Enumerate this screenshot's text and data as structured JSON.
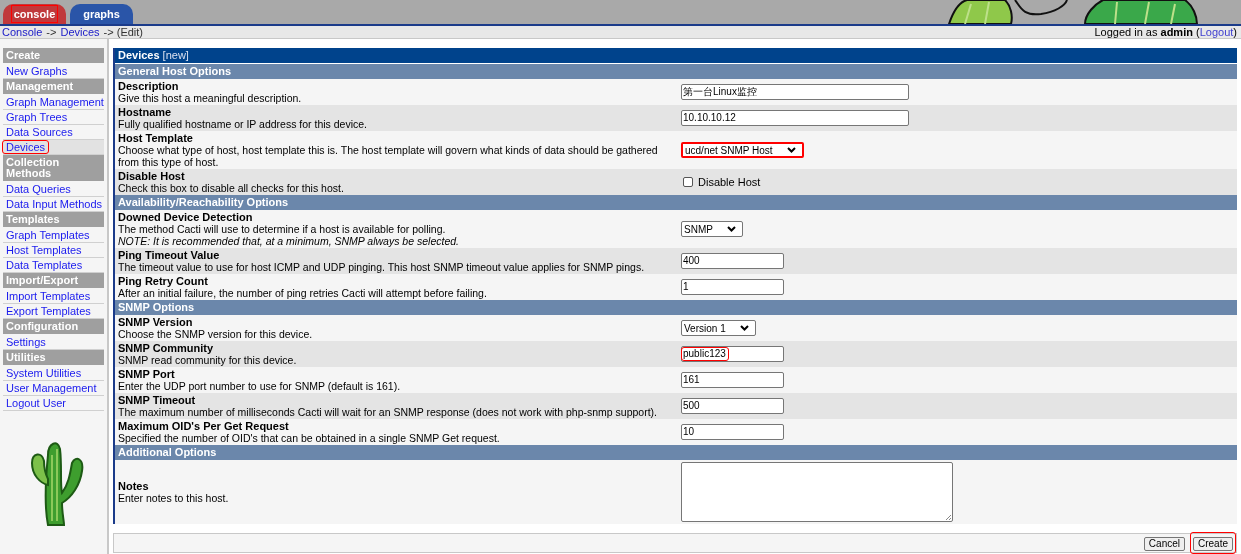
{
  "tabs": [
    {
      "label": "console",
      "selected": true,
      "highlighted": true
    },
    {
      "label": "graphs",
      "selected": false,
      "highlighted": false
    }
  ],
  "breadcrumb": [
    {
      "text": "Console",
      "kind": "link"
    },
    {
      "text": "->",
      "kind": "text"
    },
    {
      "text": "Devices",
      "kind": "link"
    },
    {
      "text": "-> (Edit)",
      "kind": "text"
    }
  ],
  "login": {
    "before": "Logged in as **admin** (",
    "link": "Logout",
    "after": ")"
  },
  "sidebar": {
    "items": [
      {
        "kind": "header",
        "label": "Create"
      },
      {
        "kind": "link",
        "label": "New Graphs",
        "selected": false,
        "highlighted": false
      },
      {
        "kind": "header",
        "label": "Management"
      },
      {
        "kind": "link",
        "label": "Graph Management",
        "selected": false,
        "highlighted": false
      },
      {
        "kind": "link",
        "label": "Graph Trees",
        "selected": false,
        "highlighted": false
      },
      {
        "kind": "link",
        "label": "Data Sources",
        "selected": false,
        "highlighted": false
      },
      {
        "kind": "link",
        "label": "Devices",
        "selected": true,
        "highlighted": true
      },
      {
        "kind": "header",
        "label": "Collection Methods"
      },
      {
        "kind": "link",
        "label": "Data Queries",
        "selected": false,
        "highlighted": false
      },
      {
        "kind": "link",
        "label": "Data Input Methods",
        "selected": false,
        "highlighted": false
      },
      {
        "kind": "header",
        "label": "Templates"
      },
      {
        "kind": "link",
        "label": "Graph Templates",
        "selected": false,
        "highlighted": false
      },
      {
        "kind": "link",
        "label": "Host Templates",
        "selected": false,
        "highlighted": false
      },
      {
        "kind": "link",
        "label": "Data Templates",
        "selected": false,
        "highlighted": false
      },
      {
        "kind": "header",
        "label": "Import/Export"
      },
      {
        "kind": "link",
        "label": "Import Templates",
        "selected": false,
        "highlighted": false
      },
      {
        "kind": "link",
        "label": "Export Templates",
        "selected": false,
        "highlighted": false
      },
      {
        "kind": "header",
        "label": "Configuration"
      },
      {
        "kind": "link",
        "label": "Settings",
        "selected": false,
        "highlighted": false
      },
      {
        "kind": "header",
        "label": "Utilities"
      },
      {
        "kind": "link",
        "label": "System Utilities",
        "selected": false,
        "highlighted": false
      },
      {
        "kind": "link",
        "label": "User Management",
        "selected": false,
        "highlighted": false
      },
      {
        "kind": "link",
        "label": "Logout User",
        "selected": false,
        "highlighted": false
      }
    ]
  },
  "form": {
    "title": "Devices",
    "tag": "[new]",
    "sections": [
      {
        "title": "General Host Options",
        "rows": [
          {
            "label": "Description",
            "description": "Give this host a meaningful description.",
            "field": {
              "kind": "text",
              "value": "第一台Linux监控",
              "highlighted": false
            }
          },
          {
            "label": "Hostname",
            "description": "Fully qualified hostname or IP address for this device.",
            "field": {
              "kind": "text",
              "value": "10.10.10.12",
              "highlighted": false
            }
          },
          {
            "label": "Host Template",
            "description": "Choose what type of host, host template this is. The host template will govern what kinds of data should be gathered from this type of host.",
            "field": {
              "kind": "select",
              "value": "ucd/net SNMP Host",
              "highlighted": true
            }
          },
          {
            "label": "Disable Host",
            "description": "Check this box to disable all checks for this host.",
            "field": {
              "kind": "checkbox",
              "value": "Disable Host",
              "checked": false
            }
          }
        ]
      },
      {
        "title": "Availability/Reachability Options",
        "rows": [
          {
            "label": "Downed Device Detection",
            "description": "The method Cacti will use to determine if a host is available for polling.",
            "note": "NOTE: It is recommended that, at a minimum, SNMP always be selected.",
            "field": {
              "kind": "select",
              "value": "SNMP",
              "highlighted": false
            }
          },
          {
            "label": "Ping Timeout Value",
            "description": "The timeout value to use for host ICMP and UDP pinging. This host SNMP timeout value applies for SNMP pings.",
            "field": {
              "kind": "text",
              "value": "400",
              "highlighted": false
            }
          },
          {
            "label": "Ping Retry Count",
            "description": "After an initial failure, the number of ping retries Cacti will attempt before failing.",
            "field": {
              "kind": "text",
              "value": "1",
              "highlighted": false
            }
          }
        ]
      },
      {
        "title": "SNMP Options",
        "rows": [
          {
            "label": "SNMP Version",
            "description": "Choose the SNMP version for this device.",
            "field": {
              "kind": "select",
              "value": "Version 1",
              "highlighted": false
            }
          },
          {
            "label": "SNMP Community",
            "description": "SNMP read community for this device.",
            "field": {
              "kind": "text",
              "value": "public123",
              "highlighted": true
            }
          },
          {
            "label": "SNMP Port",
            "description": "Enter the UDP port number to use for SNMP (default is 161).",
            "field": {
              "kind": "text",
              "value": "161",
              "highlighted": false
            }
          },
          {
            "label": "SNMP Timeout",
            "description": "The maximum number of milliseconds Cacti will wait for an SNMP response (does not work with php-snmp support).",
            "field": {
              "kind": "text",
              "value": "500",
              "highlighted": false
            }
          },
          {
            "label": "Maximum OID's Per Get Request",
            "description": "Specified the number of OID's that can be obtained in a single SNMP Get request.",
            "field": {
              "kind": "text",
              "value": "10",
              "highlighted": false
            }
          }
        ]
      },
      {
        "title": "Additional Options",
        "rows": [
          {
            "label": "Notes",
            "description": "Enter notes to this host.",
            "field": {
              "kind": "textarea",
              "highlighted": false
            }
          }
        ]
      }
    ]
  },
  "buttons": [
    {
      "label": "Cancel",
      "highlighted": false
    },
    {
      "label": "Create",
      "highlighted": true
    }
  ]
}
